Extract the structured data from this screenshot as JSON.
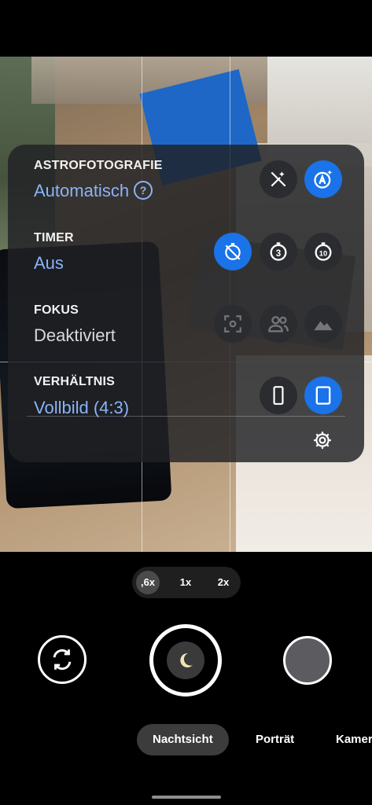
{
  "settings": {
    "astro": {
      "title": "ASTROFOTOGRAFIE",
      "value": "Automatisch",
      "help_glyph": "?"
    },
    "timer": {
      "title": "TIMER",
      "value": "Aus"
    },
    "focus": {
      "title": "FOKUS",
      "value": "Deaktiviert"
    },
    "ratio": {
      "title": "VERHÄLTNIS",
      "value": "Vollbild (4:3)"
    },
    "timer_options": [
      "3",
      "10"
    ]
  },
  "zoom": {
    "options": [
      ",6x",
      "1x",
      "2x"
    ],
    "selected": ",6x"
  },
  "modes": {
    "night": "Nachtsicht",
    "portrait": "Porträt",
    "camera": "Kamera",
    "selected": "Nachtsicht"
  },
  "colors": {
    "accent": "#1a73e8",
    "accent_text": "#8ab4f8",
    "panel": "#202124"
  },
  "icons": {
    "astro_off": "auto-awesome-off-icon",
    "astro_auto": "auto-awesome-auto-icon",
    "timer_off": "timer-off-icon",
    "timer_3": "timer-3-icon",
    "timer_10": "timer-10-icon",
    "focus_center": "center-focus-icon",
    "focus_face": "face-focus-icon",
    "focus_landscape": "landscape-icon",
    "ratio_tall": "portrait-ratio-icon",
    "ratio_full": "full-ratio-icon",
    "settings": "gear-icon",
    "switch_camera": "switch-camera-icon",
    "night": "moon-icon"
  }
}
